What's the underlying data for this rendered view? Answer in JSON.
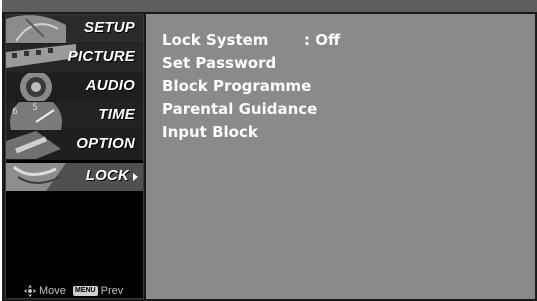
{
  "sidebar": {
    "items": [
      {
        "label": "SETUP",
        "active": false
      },
      {
        "label": "PICTURE",
        "active": false
      },
      {
        "label": "AUDIO",
        "active": false
      },
      {
        "label": "TIME",
        "active": false
      },
      {
        "label": "OPTION",
        "active": false
      },
      {
        "label": "LOCK",
        "active": true
      }
    ],
    "hints": {
      "move_label": "Move",
      "menu_key": "MENU",
      "prev_label": "Prev"
    }
  },
  "lock_menu": {
    "rows": [
      {
        "label": "Lock System",
        "value": ": Off"
      },
      {
        "label": "Set Password",
        "value": ""
      },
      {
        "label": "Block Programme",
        "value": ""
      },
      {
        "label": "Parental Guidance",
        "value": ""
      },
      {
        "label": "Input Block",
        "value": ""
      }
    ]
  },
  "colors": {
    "content_bg": "#8a8a8a",
    "sidebar_bg": "#000000",
    "text": "#ffffff"
  }
}
